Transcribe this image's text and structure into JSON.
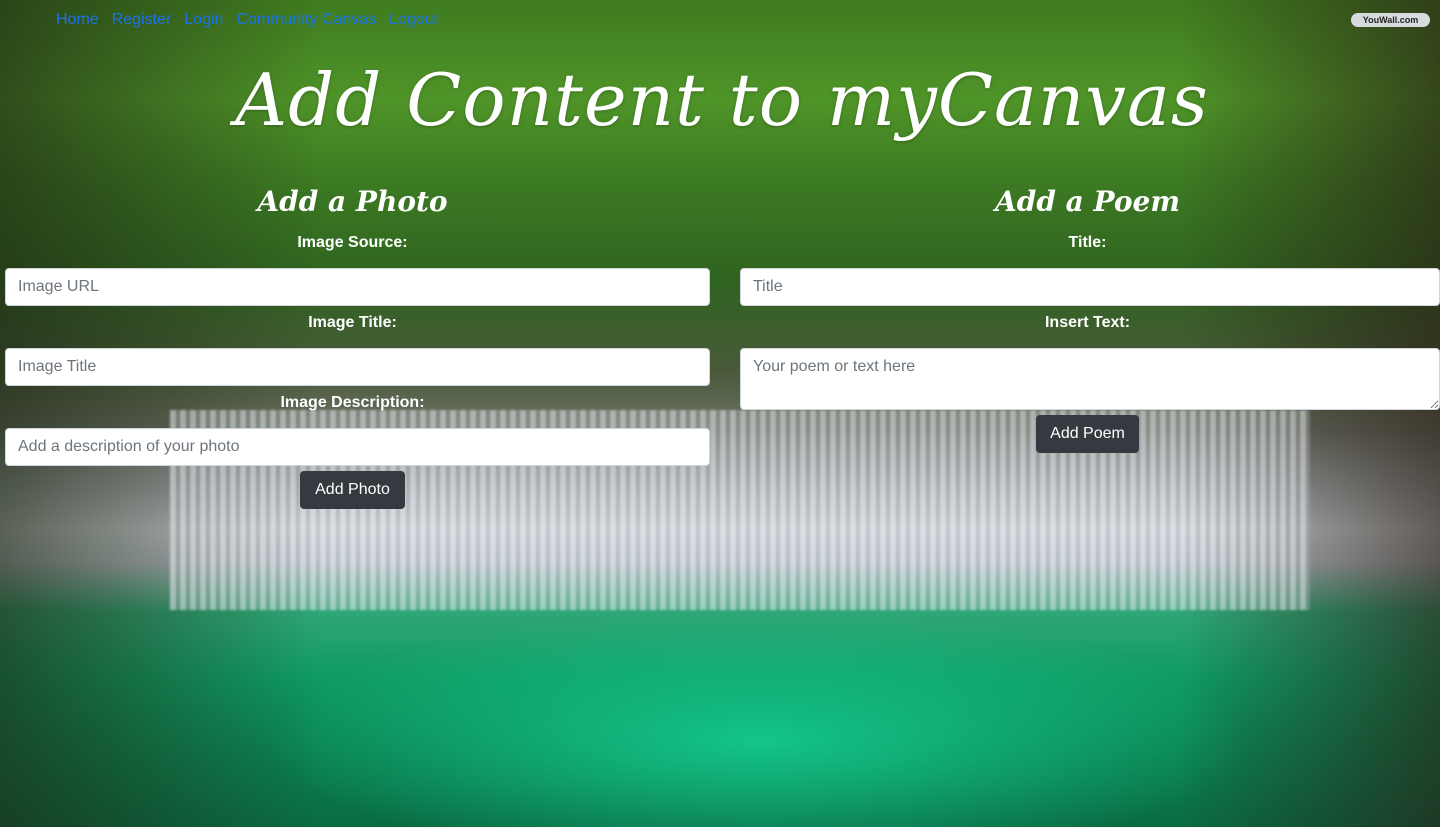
{
  "nav": {
    "items": [
      "Home",
      "Register",
      "Login",
      "Community Canvas",
      "Logout"
    ]
  },
  "badge": "YouWall.com",
  "page": {
    "title": "Add Content to myCanvas"
  },
  "photo": {
    "heading": "Add a Photo",
    "source_label": "Image Source:",
    "source_placeholder": "Image URL",
    "title_label": "Image Title:",
    "title_placeholder": "Image Title",
    "description_label": "Image Description:",
    "description_placeholder": "Add a description of your photo",
    "submit_label": "Add Photo"
  },
  "poem": {
    "heading": "Add a Poem",
    "title_label": "Title:",
    "title_placeholder": "Title",
    "text_label": "Insert Text:",
    "text_placeholder": "Your poem or text here",
    "submit_label": "Add Poem"
  },
  "colors": {
    "nav_link": "#1a73e8",
    "button_bg": "#343a40",
    "text": "#ffffff"
  }
}
